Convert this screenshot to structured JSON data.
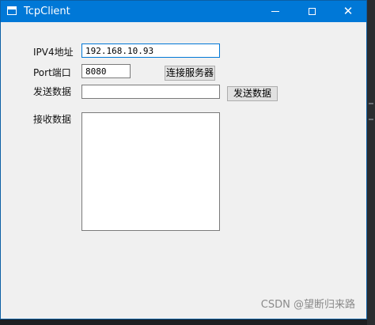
{
  "window": {
    "title": "TcpClient"
  },
  "form": {
    "ip_label": "IPV4地址",
    "ip_value": "192.168.10.93",
    "port_label": "Port端口",
    "port_value": "8080",
    "connect_button": "连接服务器",
    "send_label": "发送数据",
    "send_value": "",
    "send_button": "发送数据",
    "receive_label": "接收数据",
    "receive_value": ""
  },
  "watermark": "CSDN @望断归来路",
  "icons": {
    "app": "window-icon",
    "minimize": "minimize-icon",
    "maximize": "maximize-icon",
    "close": "close-icon"
  },
  "colors": {
    "titlebar": "#0078d7",
    "window_bg": "#f0f0f0",
    "button_bg": "#e1e1e1"
  }
}
